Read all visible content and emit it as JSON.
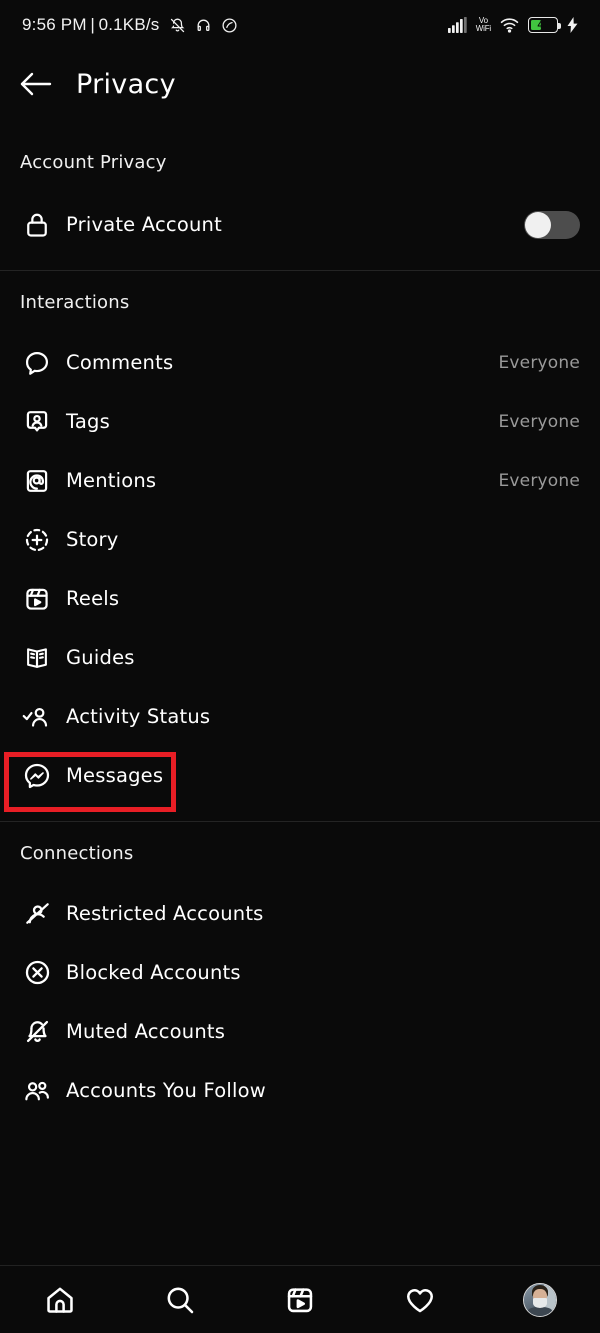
{
  "statusbar": {
    "time": "9:56 PM",
    "separator": "|",
    "data_rate": "0.1KB/s",
    "left_icons": [
      "bell-slash-icon",
      "headphone-icon",
      "dnd-icon"
    ],
    "network_label": "Vo\nWiFi",
    "network_label_line1": "Vo",
    "network_label_line2": "WiFi",
    "battery_percent": "42",
    "battery_level": 42,
    "battery_color": "#41c440",
    "charging": true
  },
  "header": {
    "back_icon": "arrow-left-icon",
    "title": "Privacy"
  },
  "sections": [
    {
      "title": "Account Privacy",
      "rows": [
        {
          "icon": "lock-icon",
          "label": "Private Account",
          "control": "toggle",
          "toggle_on": false
        }
      ]
    },
    {
      "title": "Interactions",
      "rows": [
        {
          "icon": "comment-bubble-icon",
          "label": "Comments",
          "value": "Everyone"
        },
        {
          "icon": "tag-person-icon",
          "label": "Tags",
          "value": "Everyone"
        },
        {
          "icon": "at-mention-icon",
          "label": "Mentions",
          "value": "Everyone"
        },
        {
          "icon": "story-plus-icon",
          "label": "Story",
          "value": ""
        },
        {
          "icon": "reels-clapper-icon",
          "label": "Reels",
          "value": ""
        },
        {
          "icon": "guides-book-icon",
          "label": "Guides",
          "value": ""
        },
        {
          "icon": "activity-check-person-icon",
          "label": "Activity Status",
          "value": ""
        },
        {
          "icon": "messenger-icon",
          "label": "Messages",
          "value": "",
          "highlighted": true
        }
      ]
    },
    {
      "title": "Connections",
      "rows": [
        {
          "icon": "restricted-person-slash-icon",
          "label": "Restricted Accounts",
          "value": ""
        },
        {
          "icon": "blocked-x-circle-icon",
          "label": "Blocked Accounts",
          "value": ""
        },
        {
          "icon": "muted-bell-slash-icon",
          "label": "Muted Accounts",
          "value": ""
        },
        {
          "icon": "people-group-icon",
          "label": "Accounts You Follow",
          "value": ""
        }
      ]
    }
  ],
  "annotation": {
    "target": "Messages",
    "color": "#e81e25",
    "shape": "rectangle"
  },
  "bottom_nav": [
    {
      "icon": "home-icon",
      "label": "Home"
    },
    {
      "icon": "search-icon",
      "label": "Search"
    },
    {
      "icon": "reels-icon",
      "label": "Reels"
    },
    {
      "icon": "heart-icon",
      "label": "Activity"
    },
    {
      "icon": "profile-avatar",
      "label": "Profile"
    }
  ]
}
